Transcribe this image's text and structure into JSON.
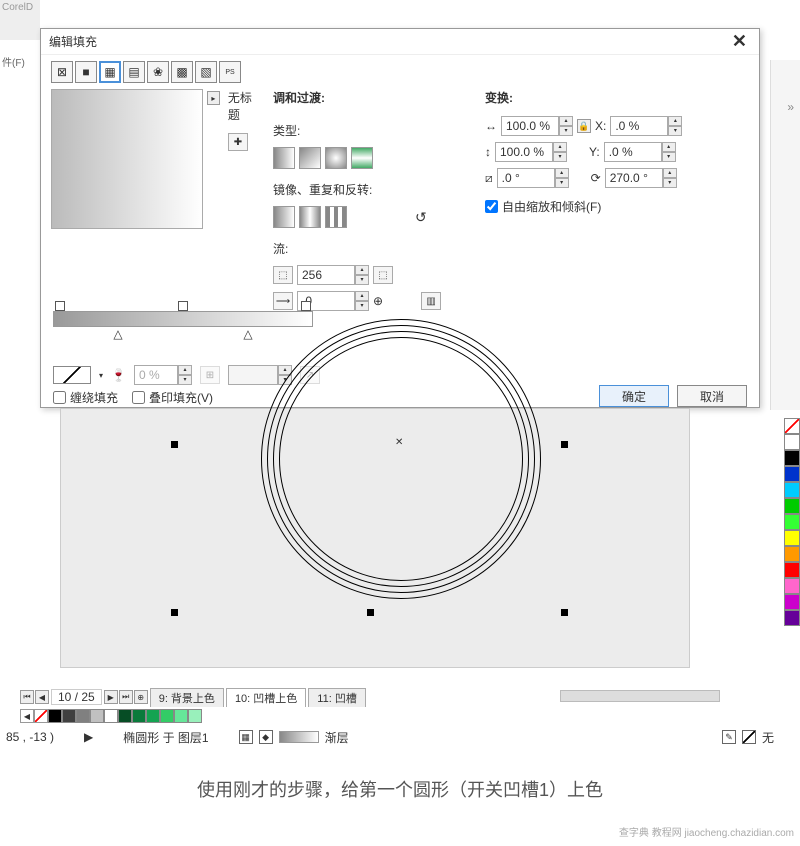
{
  "app": {
    "name_fragment": "CorelD",
    "menu_file": "件(F)"
  },
  "dialog": {
    "title": "编辑填充",
    "preset_label": "无标题",
    "section_blend": "调和过渡:",
    "label_type": "类型:",
    "label_mirror": "镜像、重复和反转:",
    "label_flow": "流:",
    "flow_steps": "256",
    "flow_offset": ".0",
    "section_transform": "变换:",
    "w_val": "100.0 %",
    "h_val": "100.0 %",
    "x_val": ".0 %",
    "y_val": ".0 %",
    "skew_val": ".0 °",
    "rot_val": "270.0 °",
    "x_label": "X:",
    "y_label": "Y:",
    "free_scale": "自由缩放和倾斜(F)",
    "node_opacity": "0 %",
    "wrap_fill": "缠绕填充",
    "overprint": "叠印填充(V)",
    "ok": "确定",
    "cancel": "取消"
  },
  "canvas": {
    "page_counter": "10 / 25",
    "tab_9": "9: 背景上色",
    "tab_10": "10: 凹槽上色",
    "tab_11": "11: 凹槽"
  },
  "status": {
    "cursor": "85 , -13 )",
    "object": "椭圆形 于 图层1",
    "fill_label": "渐层",
    "outline_label": "无"
  },
  "caption": "使用刚才的步骤，给第一个圆形（开关凹槽1）上色",
  "watermark": "查字典 教程网 jiaocheng.chazidian.com",
  "palette": [
    "#000000",
    "#404040",
    "#808080",
    "#c0c0c0",
    "#ffffff",
    "#064d25",
    "#0a7a3b",
    "#13a351",
    "#33cc66",
    "#66e699",
    "#99f0bb"
  ],
  "side_palette": [
    "#ffffff",
    "#000000",
    "#0033cc",
    "#00ccff",
    "#00cc00",
    "#33ff33",
    "#ffff00",
    "#ff9900",
    "#ff0000",
    "#ff66cc",
    "#cc00cc",
    "#660099"
  ]
}
